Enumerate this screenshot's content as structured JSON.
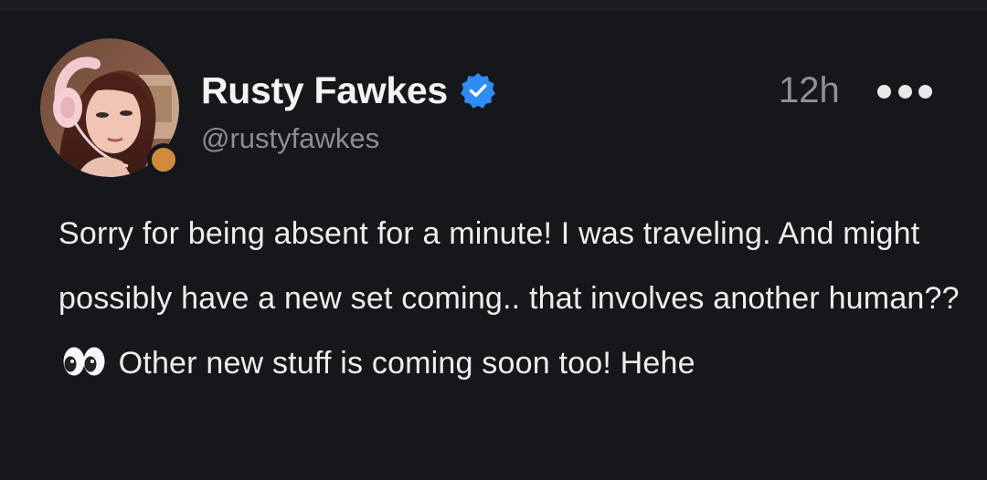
{
  "post": {
    "author": {
      "display_name": "Rusty Fawkes",
      "handle": "@rustyfawkes",
      "verified_icon": "verified-badge-icon",
      "status_color": "#d18a3c"
    },
    "time_ago": "12h",
    "more_icon": "more-options-icon",
    "text_before_emoji": "Sorry for being absent for a minute! I was traveling. And might possibly have a new set coming.. that involves another human??",
    "emoji_icon": "eyes-emoji-icon",
    "text_after_emoji": "Other new stuff is coming soon too! Hehe"
  },
  "colors": {
    "background": "#16171b",
    "accent_verified": "#2f8bf5",
    "text_primary": "#eeeef0",
    "text_secondary": "#8b8d95"
  }
}
